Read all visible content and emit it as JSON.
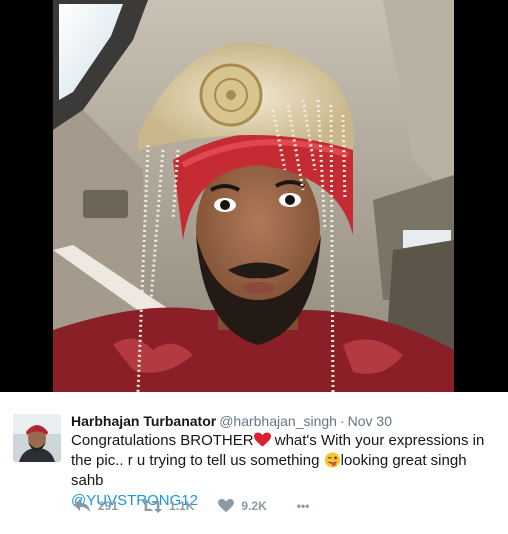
{
  "photo": {
    "subject": "selfie-in-car-wearing-groom-turban",
    "frame_color": "#000000"
  },
  "tweet": {
    "display_name": "Harbhajan Turbanator",
    "handle": "@harbhajan_singh",
    "separator": "·",
    "timestamp": "Nov 30",
    "text_part1": "Congratulations BROTHER",
    "text_part2": " what's With your expressions in the pic.. r u trying to tell us something ",
    "text_part3": "looking great singh sahb",
    "mention": "@YUVSTRONG12",
    "emoji_1": "red-heart-emoji",
    "emoji_2": "winking-face-with-tongue-emoji"
  },
  "actions": {
    "reply_count": "291",
    "retweet_count": "1.1K",
    "like_count": "9.2K",
    "more_label": "•••"
  },
  "colors": {
    "text": "#14171a",
    "secondary": "#657786",
    "action_icon": "#8b99a6",
    "mention": "#1b95e0"
  }
}
